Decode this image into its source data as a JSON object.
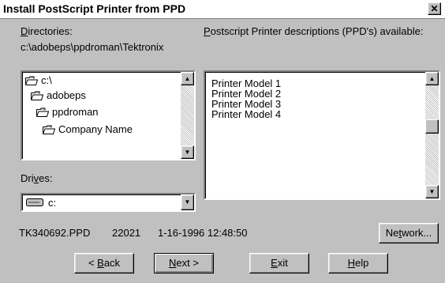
{
  "window": {
    "title": "Install PostScript Printer from PPD",
    "close_glyph": "✕"
  },
  "directories": {
    "label_accel": "D",
    "label_rest": "irectories:",
    "current_path": "c:\\adobeps\\ppdroman\\Tektronix",
    "items": [
      {
        "label": "c:\\",
        "icon": "open-folder-icon"
      },
      {
        "label": "adobeps",
        "icon": "open-folder-icon"
      },
      {
        "label": "ppdroman",
        "icon": "open-folder-icon"
      },
      {
        "label": "Company Name",
        "icon": "open-folder-icon"
      }
    ]
  },
  "drives": {
    "label_pre": "Dri",
    "label_accel": "v",
    "label_post": "es:",
    "selected": "c:",
    "icon": "drive-icon"
  },
  "ppd": {
    "label_accel": "P",
    "label_rest": "ostscript Printer descriptions (PPD's) available:",
    "items": [
      "Printer Model 1",
      "Printer Model 2",
      "Printer Model 3",
      "Printer Model 4"
    ]
  },
  "status": {
    "filename": "TK340692.PPD",
    "size": "22021",
    "datetime": "1-16-1996 12:48:50"
  },
  "buttons": {
    "network": {
      "pre": "Ne",
      "accel": "t",
      "post": "work..."
    },
    "back": {
      "pre": "< ",
      "accel": "B",
      "post": "ack"
    },
    "next": {
      "pre": "",
      "accel": "N",
      "post": "ext >"
    },
    "exit": {
      "pre": "",
      "accel": "E",
      "post": "xit"
    },
    "help": {
      "pre": "",
      "accel": "H",
      "post": "elp"
    }
  },
  "colors": {
    "face": "#c0c0c0",
    "shadow": "#808080",
    "highlight": "#ffffff",
    "folder_yellow": "#ffff99"
  }
}
